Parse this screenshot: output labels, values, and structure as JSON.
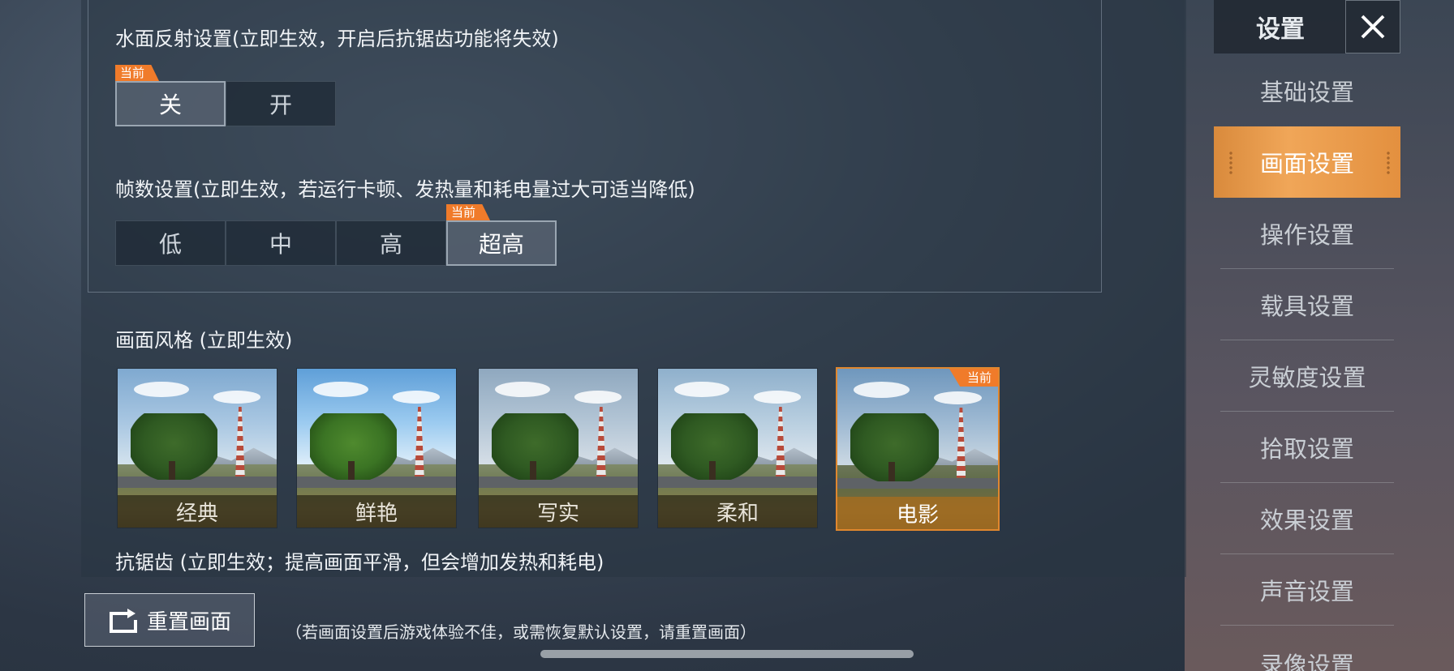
{
  "settings": {
    "water_reflection": {
      "label": "水面反射设置(立即生效，开启后抗锯齿功能将失效)",
      "current_tag": "当前",
      "options": [
        "关",
        "开"
      ],
      "selected": "关"
    },
    "frame_rate": {
      "label": "帧数设置(立即生效，若运行卡顿、发热量和耗电量过大可适当降低)",
      "current_tag": "当前",
      "options": [
        "低",
        "中",
        "高",
        "超高"
      ],
      "selected": "超高"
    },
    "graphics_style": {
      "label": "画面风格 (立即生效)",
      "current_tag": "当前",
      "options": [
        "经典",
        "鲜艳",
        "写实",
        "柔和",
        "电影"
      ],
      "selected": "电影"
    },
    "anti_aliasing": {
      "label": "抗锯齿 (立即生效；提高画面平滑，但会增加发热和耗电)"
    }
  },
  "reset": {
    "button_label": "重置画面",
    "hint": "（若画面设置后游戏体验不佳，或需恢复默认设置，请重置画面）"
  },
  "sidebar": {
    "title": "设置",
    "close_icon": "close-icon",
    "items": [
      {
        "label": "基础设置"
      },
      {
        "label": "画面设置",
        "active": true
      },
      {
        "label": "操作设置"
      },
      {
        "label": "载具设置"
      },
      {
        "label": "灵敏度设置"
      },
      {
        "label": "拾取设置"
      },
      {
        "label": "效果设置"
      },
      {
        "label": "声音设置"
      },
      {
        "label": "录像设置"
      }
    ]
  },
  "colors": {
    "accent": "#f07b2a",
    "active_tab": "#f0a658"
  }
}
